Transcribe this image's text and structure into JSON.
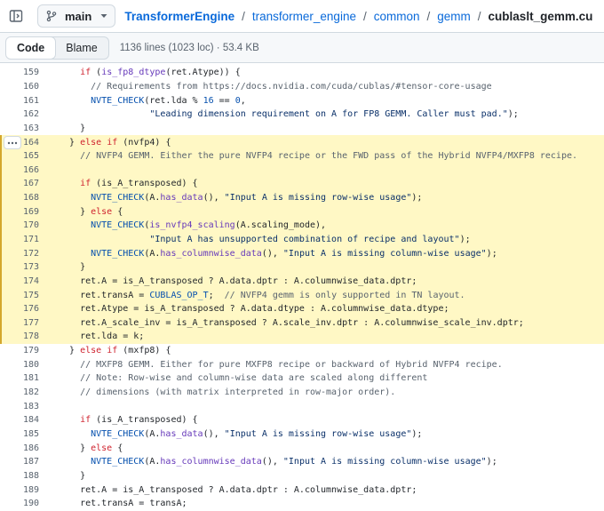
{
  "header": {
    "branch": "main",
    "breadcrumb": {
      "repo": "TransformerEngine",
      "dirs": [
        "transformer_engine",
        "common",
        "gemm"
      ],
      "separator": "/",
      "file": "cublaslt_gemm.cu"
    }
  },
  "file_toolbar": {
    "code_tab": "Code",
    "blame_tab": "Blame",
    "meta": "1136 lines (1023 loc) · 53.4 KB"
  },
  "code": {
    "highlighted_lines": [
      "164",
      "165",
      "166",
      "167",
      "168",
      "169",
      "170",
      "171",
      "172",
      "173",
      "174",
      "175",
      "176",
      "177",
      "178"
    ],
    "lines": [
      {
        "n": "159",
        "t": "    if (is_fp8_dtype(ret.Atype)) {"
      },
      {
        "n": "160",
        "t": "      // Requirements from https://docs.nvidia.com/cuda/cublas/#tensor-core-usage"
      },
      {
        "n": "161",
        "t": "      NVTE_CHECK(ret.lda % 16 == 0,"
      },
      {
        "n": "162",
        "t": "                 \"Leading dimension requirement on A for FP8 GEMM. Caller must pad.\");"
      },
      {
        "n": "163",
        "t": "    }"
      },
      {
        "n": "164",
        "t": "  } else if (nvfp4) {"
      },
      {
        "n": "165",
        "t": "    // NVFP4 GEMM. Either the pure NVFP4 recipe or the FWD pass of the Hybrid NVFP4/MXFP8 recipe."
      },
      {
        "n": "166",
        "t": ""
      },
      {
        "n": "167",
        "t": "    if (is_A_transposed) {"
      },
      {
        "n": "168",
        "t": "      NVTE_CHECK(A.has_data(), \"Input A is missing row-wise usage\");"
      },
      {
        "n": "169",
        "t": "    } else {"
      },
      {
        "n": "170",
        "t": "      NVTE_CHECK(is_nvfp4_scaling(A.scaling_mode),"
      },
      {
        "n": "171",
        "t": "                 \"Input A has unsupported combination of recipe and layout\");"
      },
      {
        "n": "172",
        "t": "      NVTE_CHECK(A.has_columnwise_data(), \"Input A is missing column-wise usage\");"
      },
      {
        "n": "173",
        "t": "    }"
      },
      {
        "n": "174",
        "t": "    ret.A = is_A_transposed ? A.data.dptr : A.columnwise_data.dptr;"
      },
      {
        "n": "175",
        "t": "    ret.transA = CUBLAS_OP_T;  // NVFP4 gemm is only supported in TN layout."
      },
      {
        "n": "176",
        "t": "    ret.Atype = is_A_transposed ? A.data.dtype : A.columnwise_data.dtype;"
      },
      {
        "n": "177",
        "t": "    ret.A_scale_inv = is_A_transposed ? A.scale_inv.dptr : A.columnwise_scale_inv.dptr;"
      },
      {
        "n": "178",
        "t": "    ret.lda = k;"
      },
      {
        "n": "179",
        "t": "  } else if (mxfp8) {"
      },
      {
        "n": "180",
        "t": "    // MXFP8 GEMM. Either for pure MXFP8 recipe or backward of Hybrid NVFP4 recipe."
      },
      {
        "n": "181",
        "t": "    // Note: Row-wise and column-wise data are scaled along different"
      },
      {
        "n": "182",
        "t": "    // dimensions (with matrix interpreted in row-major order)."
      },
      {
        "n": "183",
        "t": ""
      },
      {
        "n": "184",
        "t": "    if (is_A_transposed) {"
      },
      {
        "n": "185",
        "t": "      NVTE_CHECK(A.has_data(), \"Input A is missing row-wise usage\");"
      },
      {
        "n": "186",
        "t": "    } else {"
      },
      {
        "n": "187",
        "t": "      NVTE_CHECK(A.has_columnwise_data(), \"Input A is missing column-wise usage\");"
      },
      {
        "n": "188",
        "t": "    }"
      },
      {
        "n": "189",
        "t": "    ret.A = is_A_transposed ? A.data.dptr : A.columnwise_data.dptr;"
      },
      {
        "n": "190",
        "t": "    ret.transA = transA;"
      }
    ]
  }
}
